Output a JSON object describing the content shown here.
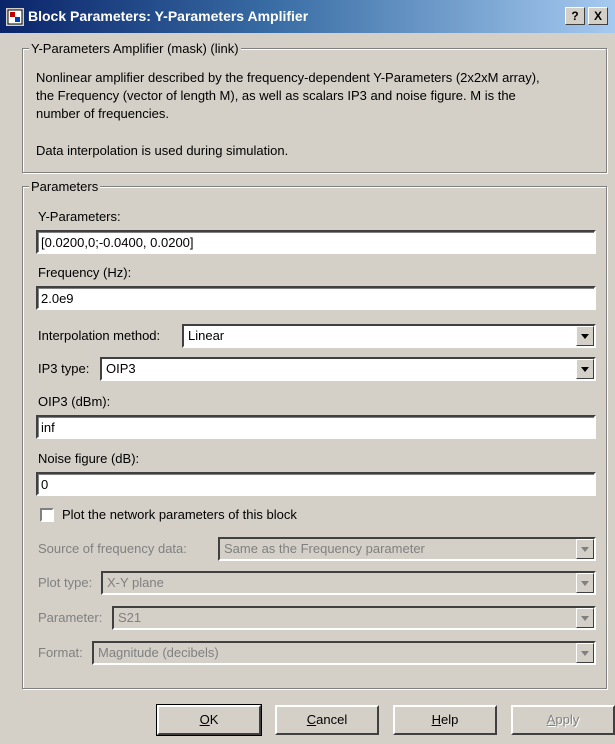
{
  "window": {
    "title": "Block Parameters: Y-Parameters Amplifier",
    "help_label": "?",
    "close_label": "X"
  },
  "mask": {
    "legend": "Y-Parameters Amplifier (mask) (link)",
    "description_lines": [
      "Nonlinear amplifier described by the frequency-dependent Y-Parameters (2x2xM array),",
      "the Frequency (vector of length M), as well as scalars IP3 and noise figure. M is the",
      "number of frequencies."
    ],
    "note": "Data interpolation is used during simulation."
  },
  "parameters": {
    "legend": "Parameters",
    "y_parameters": {
      "label": "Y-Parameters:",
      "value": "[0.0200,0;-0.0400, 0.0200]"
    },
    "frequency": {
      "label": "Frequency (Hz):",
      "value": "2.0e9"
    },
    "interpolation": {
      "label": "Interpolation method:",
      "value": "Linear"
    },
    "ip3_type": {
      "label": "IP3 type:",
      "value": "OIP3"
    },
    "oip3": {
      "label": "OIP3 (dBm):",
      "value": "inf"
    },
    "noise_figure": {
      "label": "Noise figure (dB):",
      "value": "0"
    },
    "plot_checkbox": {
      "label": "Plot the network parameters of this block",
      "checked": false
    },
    "source_freq": {
      "label": "Source of frequency data:",
      "value": "Same as the Frequency parameter"
    },
    "plot_type": {
      "label": "Plot type:",
      "value": "X-Y plane"
    },
    "parameter": {
      "label": "Parameter:",
      "value": "S21"
    },
    "format": {
      "label": "Format:",
      "value": "Magnitude (decibels)"
    }
  },
  "buttons": {
    "ok": {
      "mnemonic": "O",
      "rest": "K"
    },
    "cancel": {
      "mnemonic": "C",
      "rest": "ancel"
    },
    "help": {
      "mnemonic": "H",
      "rest": "elp"
    },
    "apply": {
      "mnemonic": "A",
      "rest": "pply"
    }
  }
}
